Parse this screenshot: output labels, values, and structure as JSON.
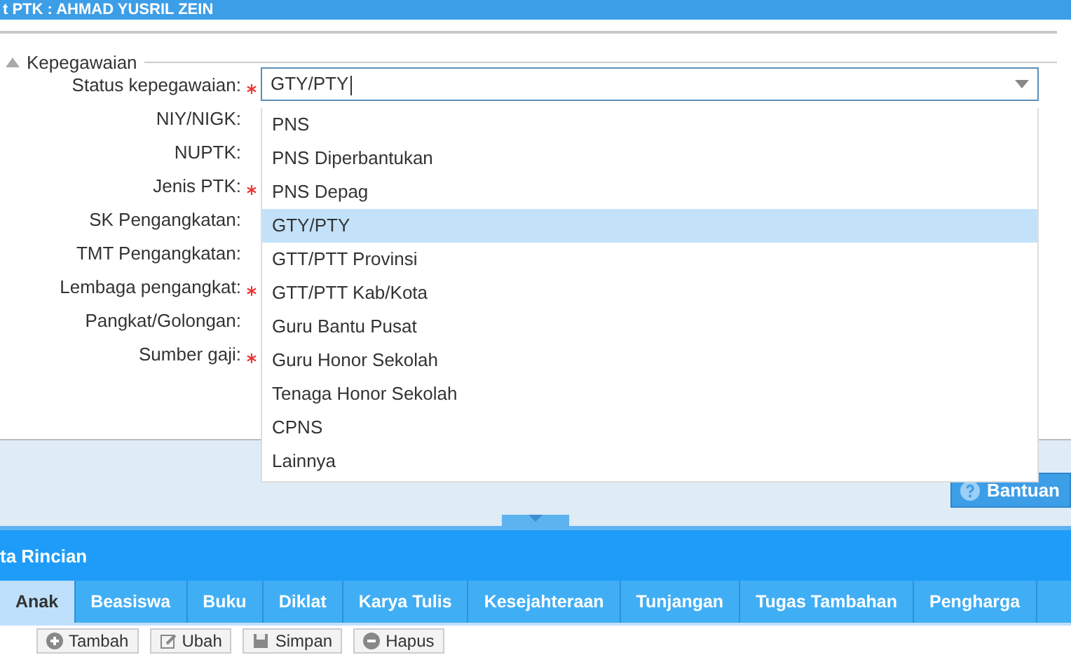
{
  "window": {
    "title": "t PTK : AHMAD YUSRIL ZEIN"
  },
  "fieldset": {
    "legend": "Kepegawaian",
    "expanded": true
  },
  "form": [
    {
      "label": "Status kepegawaian:",
      "required": true
    },
    {
      "label": "NIY/NIGK:",
      "required": false
    },
    {
      "label": "NUPTK:",
      "required": false
    },
    {
      "label": "Jenis PTK:",
      "required": true
    },
    {
      "label": "SK Pengangkatan:",
      "required": false
    },
    {
      "label": "TMT Pengangkatan:",
      "required": false
    },
    {
      "label": "Lembaga pengangkat:",
      "required": true
    },
    {
      "label": "Pangkat/Golongan:",
      "required": false
    },
    {
      "label": "Sumber gaji:",
      "required": true
    }
  ],
  "status_combo": {
    "value": "GTY/PTY",
    "options": [
      {
        "label": "PNS",
        "selected": false
      },
      {
        "label": "PNS Diperbantukan",
        "selected": false
      },
      {
        "label": "PNS Depag",
        "selected": false
      },
      {
        "label": "GTY/PTY",
        "selected": true
      },
      {
        "label": "GTT/PTT Provinsi",
        "selected": false
      },
      {
        "label": "GTT/PTT Kab/Kota",
        "selected": false
      },
      {
        "label": "Guru Bantu Pusat",
        "selected": false
      },
      {
        "label": "Guru Honor Sekolah",
        "selected": false
      },
      {
        "label": "Tenaga Honor Sekolah",
        "selected": false
      },
      {
        "label": "CPNS",
        "selected": false
      },
      {
        "label": "Lainnya",
        "selected": false
      }
    ]
  },
  "help_button": "Bantuan",
  "detail_panel": {
    "title": "ta Rincian"
  },
  "tabs": [
    {
      "label": "Anak",
      "selected": true
    },
    {
      "label": "Beasiswa",
      "selected": false
    },
    {
      "label": "Buku",
      "selected": false
    },
    {
      "label": "Diklat",
      "selected": false
    },
    {
      "label": "Karya Tulis",
      "selected": false
    },
    {
      "label": "Kesejahteraan",
      "selected": false
    },
    {
      "label": "Tunjangan",
      "selected": false
    },
    {
      "label": "Tugas Tambahan",
      "selected": false
    },
    {
      "label": "Pengharga",
      "selected": false
    }
  ],
  "toolbar": [
    {
      "label": "Tambah",
      "kind": "add"
    },
    {
      "label": "Ubah",
      "kind": "edit"
    },
    {
      "label": "Simpan",
      "kind": "save"
    },
    {
      "label": "Hapus",
      "kind": "delete"
    }
  ]
}
